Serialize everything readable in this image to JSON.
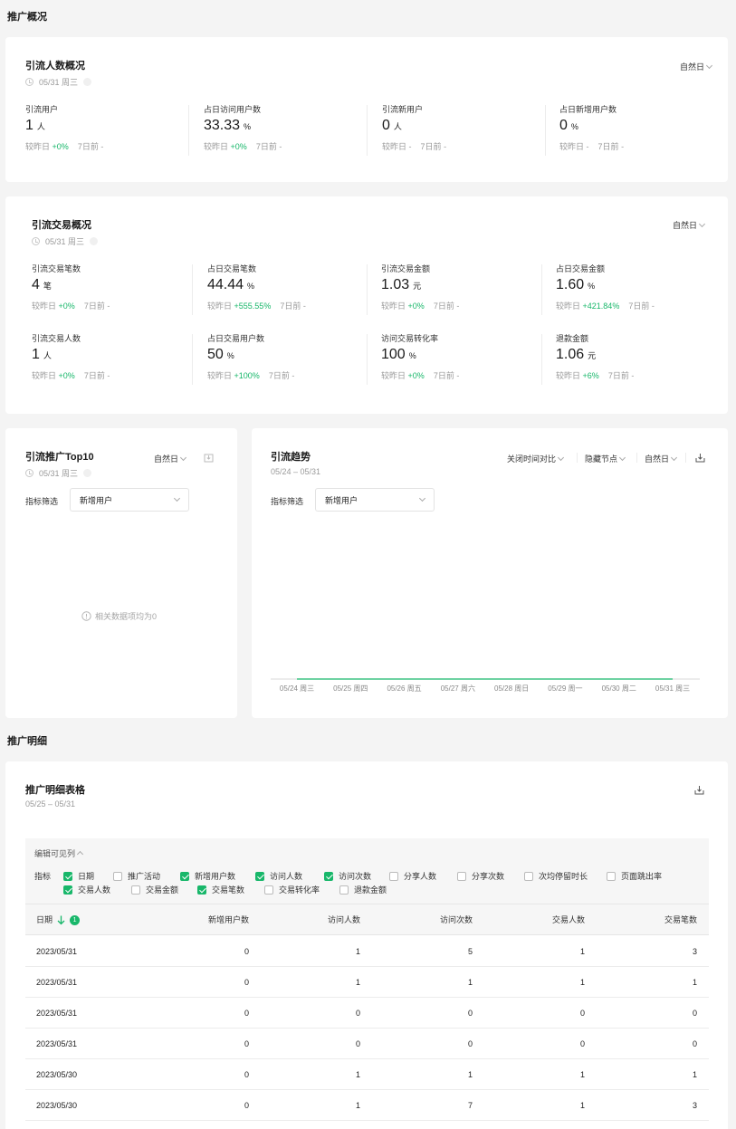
{
  "section1": {
    "title": "推广概况"
  },
  "card1": {
    "title": "引流人数概况",
    "date": "05/31 周三",
    "period": "自然日",
    "metrics": [
      {
        "label": "引流用户",
        "value": "1",
        "unit": "人",
        "cmp_label": "较昨日",
        "cmp": "+0%",
        "week_label": "7日前",
        "week": "-"
      },
      {
        "label": "占日访问用户数",
        "value": "33.33",
        "unit": "%",
        "cmp_label": "较昨日",
        "cmp": "+0%",
        "week_label": "7日前",
        "week": "-"
      },
      {
        "label": "引流新用户",
        "value": "0",
        "unit": "人",
        "cmp_label": "较昨日",
        "cmp": "-",
        "week_label": "7日前",
        "week": "-"
      },
      {
        "label": "占日新增用户数",
        "value": "0",
        "unit": "%",
        "cmp_label": "较昨日",
        "cmp": "-",
        "week_label": "7日前",
        "week": "-"
      }
    ]
  },
  "card2": {
    "title": "引流交易概况",
    "date": "05/31 周三",
    "period": "自然日",
    "metrics": [
      {
        "label": "引流交易笔数",
        "value": "4",
        "unit": "笔",
        "cmp_label": "较昨日",
        "cmp": "+0%",
        "week_label": "7日前",
        "week": "-"
      },
      {
        "label": "占日交易笔数",
        "value": "44.44",
        "unit": "%",
        "cmp_label": "较昨日",
        "cmp": "+555.55%",
        "week_label": "7日前",
        "week": "-"
      },
      {
        "label": "引流交易金额",
        "value": "1.03",
        "unit": "元",
        "cmp_label": "较昨日",
        "cmp": "+0%",
        "week_label": "7日前",
        "week": "-"
      },
      {
        "label": "占日交易金额",
        "value": "1.60",
        "unit": "%",
        "cmp_label": "较昨日",
        "cmp": "+421.84%",
        "week_label": "7日前",
        "week": "-"
      },
      {
        "label": "引流交易人数",
        "value": "1",
        "unit": "人",
        "cmp_label": "较昨日",
        "cmp": "+0%",
        "week_label": "7日前",
        "week": "-"
      },
      {
        "label": "占日交易用户数",
        "value": "50",
        "unit": "%",
        "cmp_label": "较昨日",
        "cmp": "+100%",
        "week_label": "7日前",
        "week": "-"
      },
      {
        "label": "访问交易转化率",
        "value": "100",
        "unit": "%",
        "cmp_label": "较昨日",
        "cmp": "+0%",
        "week_label": "7日前",
        "week": "-"
      },
      {
        "label": "退款金额",
        "value": "1.06",
        "unit": "元",
        "cmp_label": "较昨日",
        "cmp": "+6%",
        "week_label": "7日前",
        "week": "-"
      }
    ]
  },
  "top10": {
    "title": "引流推广Top10",
    "date": "05/31 周三",
    "period": "自然日",
    "filter_label": "指标筛选",
    "filter_value": "新增用户",
    "empty": "相关数据项均为0"
  },
  "trend": {
    "title": "引流趋势",
    "range": "05/24 – 05/31",
    "compare": "关闭时间对比",
    "hide_nodes": "隐藏节点",
    "period": "自然日",
    "filter_label": "指标筛选",
    "filter_value": "新增用户"
  },
  "chart_data": {
    "type": "line",
    "categories": [
      "05/24 周三",
      "05/25 周四",
      "05/26 周五",
      "05/27 周六",
      "05/28 周日",
      "05/29 周一",
      "05/30 周二",
      "05/31 周三"
    ],
    "series": [
      {
        "values": [
          0,
          0,
          0,
          0,
          0,
          0,
          0,
          0
        ],
        "color": "#18b76a"
      }
    ],
    "grid": false
  },
  "section2": {
    "title": "推广明细"
  },
  "detail": {
    "title": "推广明细表格",
    "range": "05/25 – 05/31",
    "edit_cols": "编辑可见列",
    "metric_label": "指标",
    "options": [
      {
        "label": "日期",
        "checked": true
      },
      {
        "label": "推广活动",
        "checked": false
      },
      {
        "label": "新增用户数",
        "checked": true
      },
      {
        "label": "访问人数",
        "checked": true
      },
      {
        "label": "访问次数",
        "checked": true
      },
      {
        "label": "分享人数",
        "checked": false
      },
      {
        "label": "分享次数",
        "checked": false
      },
      {
        "label": "次均停留时长",
        "checked": false
      },
      {
        "label": "页面跳出率",
        "checked": false
      },
      {
        "label": "交易人数",
        "checked": true
      },
      {
        "label": "交易金额",
        "checked": false
      },
      {
        "label": "交易笔数",
        "checked": true
      },
      {
        "label": "交易转化率",
        "checked": false
      },
      {
        "label": "退款金额",
        "checked": false
      }
    ],
    "sort_badge": "1",
    "columns": [
      "日期",
      "新增用户数",
      "访问人数",
      "访问次数",
      "交易人数",
      "交易笔数"
    ],
    "rows": [
      [
        "2023/05/31",
        "0",
        "1",
        "5",
        "1",
        "3"
      ],
      [
        "2023/05/31",
        "0",
        "1",
        "1",
        "1",
        "1"
      ],
      [
        "2023/05/31",
        "0",
        "0",
        "0",
        "0",
        "0"
      ],
      [
        "2023/05/31",
        "0",
        "0",
        "0",
        "0",
        "0"
      ],
      [
        "2023/05/30",
        "0",
        "1",
        "1",
        "1",
        "1"
      ],
      [
        "2023/05/30",
        "0",
        "1",
        "7",
        "1",
        "3"
      ]
    ]
  }
}
